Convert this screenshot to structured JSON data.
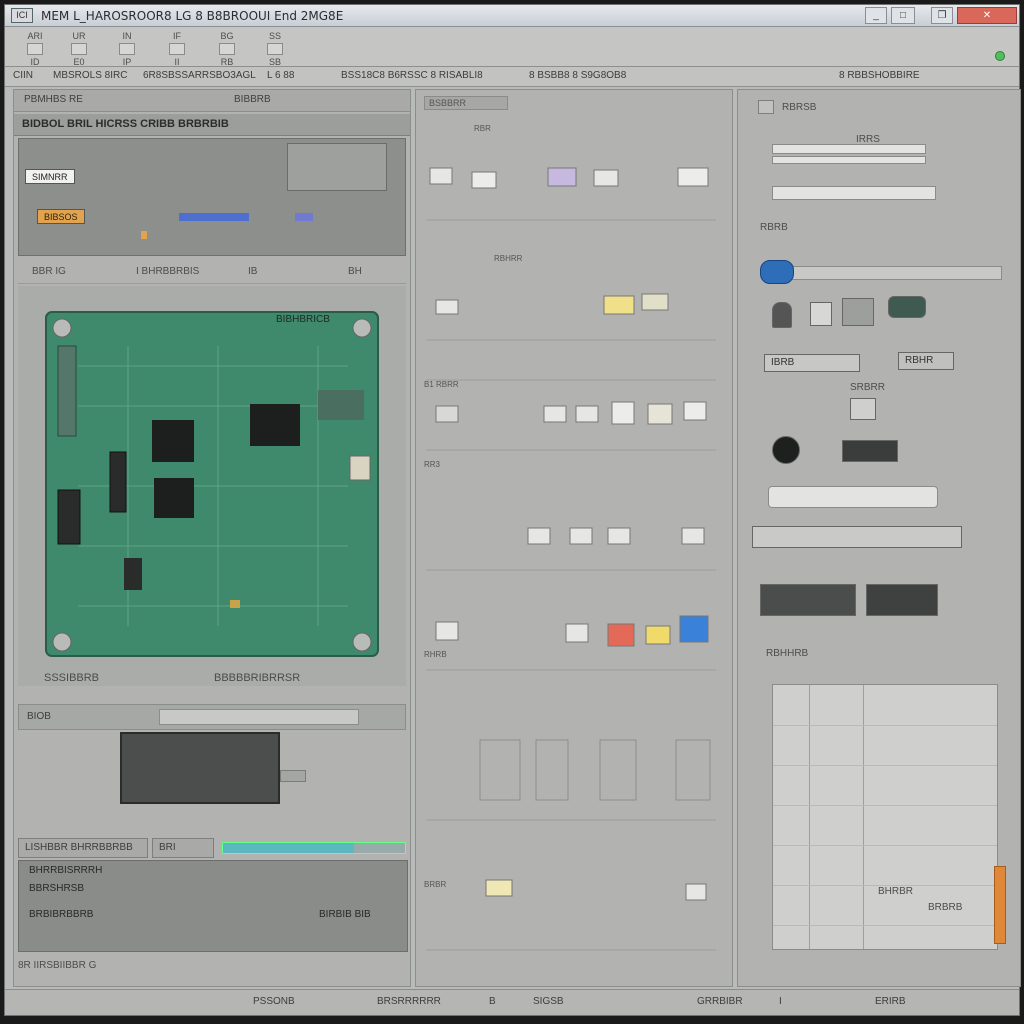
{
  "window": {
    "title": "MEM L_HAROSROOR8 LG 8  B8BROOUI End 2MG8E",
    "app_icon_label": "ICI"
  },
  "title_buttons": {
    "minimize": "_",
    "maximize": "□",
    "restore": "❐",
    "close": "✕"
  },
  "toolbar": {
    "buttons": [
      {
        "label": "ARI",
        "sub": "ID"
      },
      {
        "label": "UR",
        "sub": "E0"
      },
      {
        "label": "IN",
        "sub": "IP"
      },
      {
        "label": "IF",
        "sub": "II"
      },
      {
        "label": "BG",
        "sub": "RB"
      },
      {
        "label": "SS",
        "sub": "SB"
      }
    ]
  },
  "menubar": {
    "items": [
      "CIIN",
      "MBSROLS 8IRC",
      "6R8SBSSARRSBO3AGL",
      "L 6 88",
      "BSS18C8 B6RSSC 8 RISABLI8",
      "8 BSBB8 8 S9G8OB8",
      "8 RBBSHOBBIRE"
    ]
  },
  "left_panel": {
    "header_left": "PBMHBS RE",
    "header_right": "BIBBRB",
    "sub_header": "BIDBOL  BRIL  HICRSS CRIBB   BRBRBIB",
    "chips": [
      {
        "label": "SIMNRR",
        "style": "white"
      },
      {
        "label": "BIBSOS",
        "style": "orange"
      }
    ],
    "preview_labels": [
      "BBR   IG",
      "I BHRBBRBIS",
      "IB",
      "BH"
    ],
    "pcb_label": "BIBHBRICB",
    "pcb_caption_left": "SSSIBBRB",
    "pcb_caption_right": "BBBBBRIBRRSR",
    "input_label": "BIOB",
    "tabs": [
      "LISHBBR BHRRBBRBB",
      "BRI"
    ],
    "progress": 0.72,
    "log_lines": [
      "BHRRBISRRRH",
      "BBRSHRSB",
      "BRBIBRBBRB",
      "BIRBIB    BIB"
    ],
    "footer": "8R IIRSBIIBBR G"
  },
  "mid_panel": {
    "search": "BSBBRR",
    "labels": [
      "RBR",
      "RBHRR",
      "B1 RBRR",
      "RR3",
      "RHRB",
      "BRBR"
    ]
  },
  "right_panel": {
    "labels": [
      "RBRSB",
      "IRRS",
      "RBRB",
      "SRBRR",
      "RBHHRB",
      "BHRBR",
      "BRBRB"
    ],
    "chips": [
      "IBRB",
      "RBHR"
    ]
  },
  "statusbar": {
    "items": [
      "PSSONB",
      "BRSRRRRRR",
      "B",
      "SIGSB",
      "GRRBIBR",
      "I",
      "ERIRB"
    ]
  },
  "colors": {
    "pcb_green": "#3f8a6c",
    "accent_orange": "#e0883a",
    "slider_blue": "#2e6db7",
    "close_red": "#d9685a"
  }
}
